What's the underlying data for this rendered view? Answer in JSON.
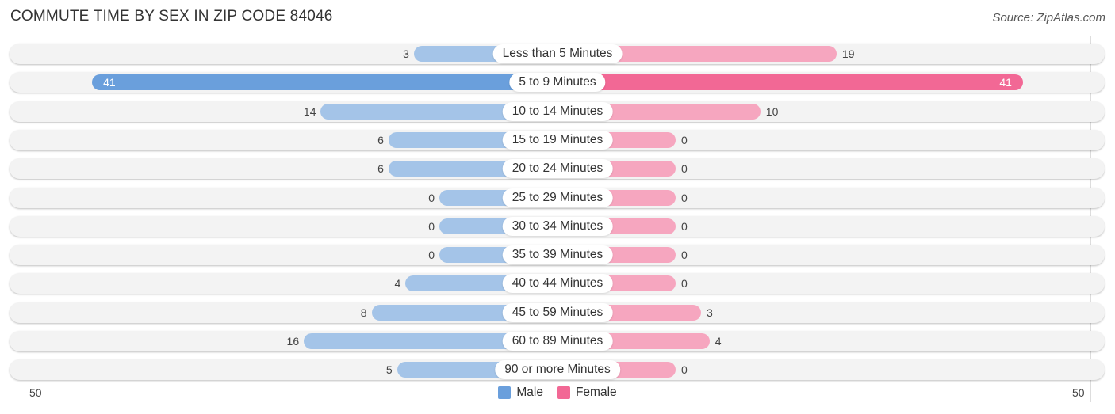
{
  "header": {
    "title": "COMMUTE TIME BY SEX IN ZIP CODE 84046",
    "source": "Source: ZipAtlas.com"
  },
  "colors": {
    "male": "#6a9fdc",
    "male_light": "#a4c4e8",
    "female": "#f26895",
    "female_light": "#f6a6bf"
  },
  "chart_data": {
    "type": "bar",
    "orientation": "horizontal-diverging",
    "title": "COMMUTE TIME BY SEX IN ZIP CODE 84046",
    "categories": [
      "Less than 5 Minutes",
      "5 to 9 Minutes",
      "10 to 14 Minutes",
      "15 to 19 Minutes",
      "20 to 24 Minutes",
      "25 to 29 Minutes",
      "30 to 34 Minutes",
      "35 to 39 Minutes",
      "40 to 44 Minutes",
      "45 to 59 Minutes",
      "60 to 89 Minutes",
      "90 or more Minutes"
    ],
    "series": [
      {
        "name": "Male",
        "values": [
          3,
          41,
          14,
          6,
          6,
          0,
          0,
          0,
          4,
          8,
          16,
          5
        ]
      },
      {
        "name": "Female",
        "values": [
          19,
          41,
          10,
          0,
          0,
          0,
          0,
          0,
          0,
          3,
          4,
          0
        ]
      }
    ],
    "axis": {
      "left_label": "50",
      "right_label": "50",
      "max": 50
    },
    "legend": {
      "position": "bottom-center",
      "entries": [
        "Male",
        "Female"
      ]
    }
  }
}
